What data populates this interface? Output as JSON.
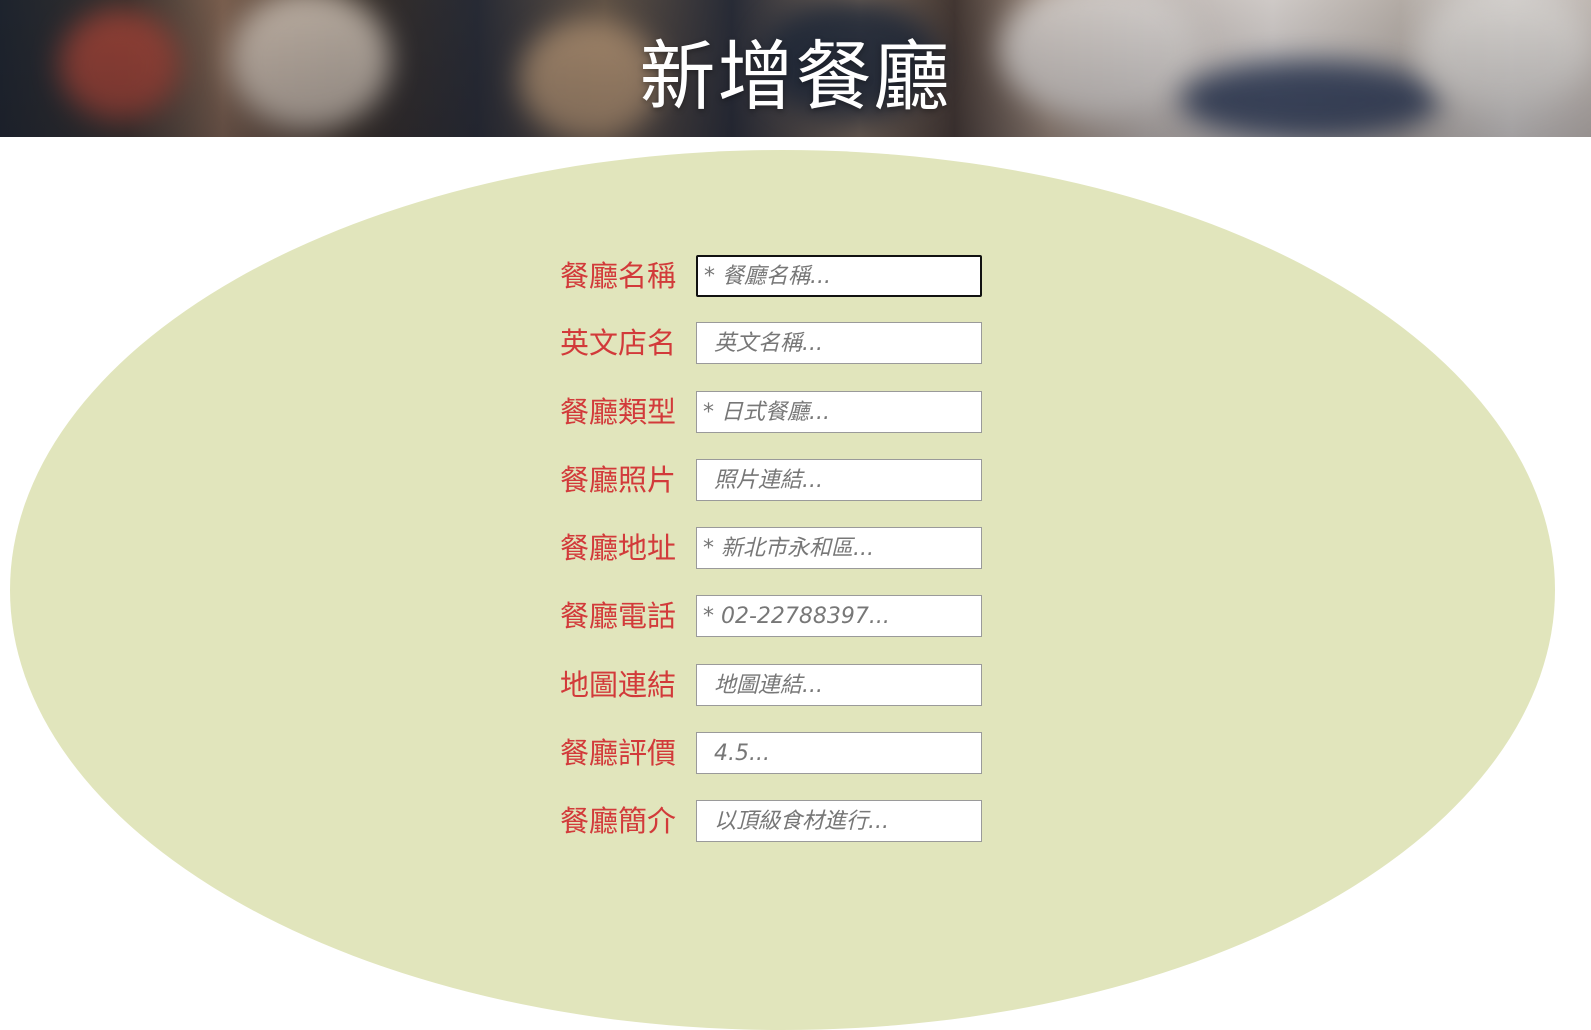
{
  "header": {
    "title": "新增餐廳"
  },
  "form": {
    "fields": [
      {
        "label": "餐廳名稱",
        "placeholder": "* 餐廳名稱..."
      },
      {
        "label": "英文店名",
        "placeholder": "英文名稱..."
      },
      {
        "label": "餐廳類型",
        "placeholder": "* 日式餐廳..."
      },
      {
        "label": "餐廳照片",
        "placeholder": "照片連結..."
      },
      {
        "label": "餐廳地址",
        "placeholder": "* 新北市永和區..."
      },
      {
        "label": "餐廳電話",
        "placeholder": "* 02-22788397..."
      },
      {
        "label": "地圖連結",
        "placeholder": "地圖連結..."
      },
      {
        "label": "餐廳評價",
        "placeholder": "4.5..."
      },
      {
        "label": "餐廳簡介",
        "placeholder": "以頂級食材進行..."
      }
    ]
  },
  "colors": {
    "label": "#d23a3a",
    "oval_background": "#e1e5bc",
    "title": "#ffffff"
  }
}
